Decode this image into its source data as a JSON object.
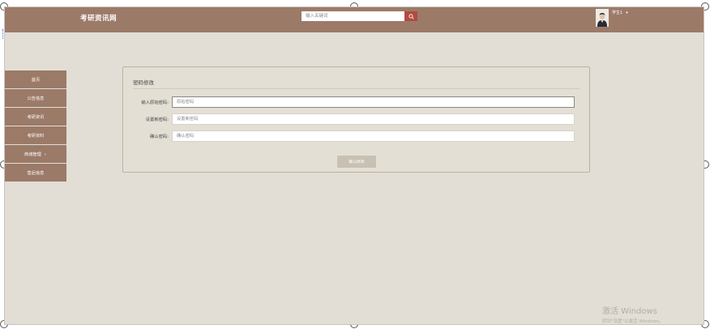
{
  "header": {
    "brand": "考研资讯网",
    "search_placeholder": "输入关键词",
    "username": "学生1",
    "user_caret": "▾"
  },
  "sidebar": {
    "items": [
      {
        "label": "首页"
      },
      {
        "label": "公告信息"
      },
      {
        "label": "考研资讯"
      },
      {
        "label": "考研资料"
      },
      {
        "label": "商城管理",
        "chevron": "⌄"
      },
      {
        "label": "售后信息"
      }
    ]
  },
  "panel": {
    "title": "密码修改",
    "fields": [
      {
        "label": "输入原始密码:",
        "placeholder": "原始密码"
      },
      {
        "label": "设置新密码:",
        "placeholder": "设置新密码"
      },
      {
        "label": "确认密码:",
        "placeholder": "确认密码"
      }
    ],
    "submit_label": "确认修改"
  },
  "watermark": {
    "title": "激活 Windows",
    "subtitle": "转到\"设置\"以激活 Windows。"
  },
  "colors": {
    "header_bg": "#9c7a68",
    "page_bg": "#e2ded5",
    "search_button": "#b24a40",
    "submit_button": "#c8c1b3"
  },
  "icons": {
    "search": "search-icon",
    "avatar": "user-avatar"
  }
}
